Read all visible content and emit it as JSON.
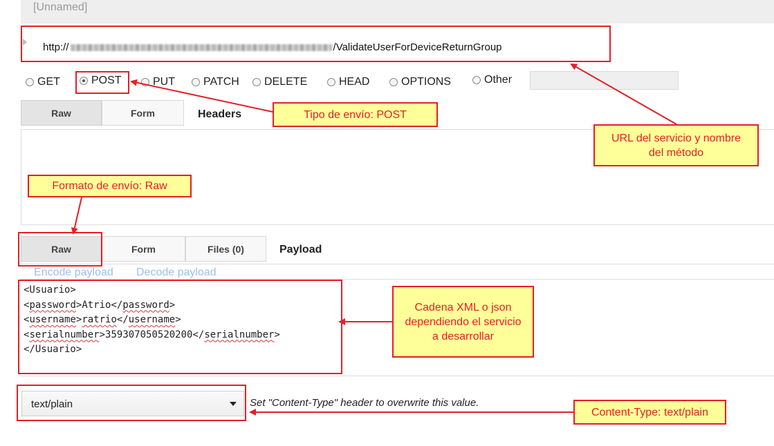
{
  "window": {
    "title": "[Unnamed]"
  },
  "request": {
    "url_prefix": "http://",
    "url_suffix": "/ValidateUserForDeviceReturnGroup"
  },
  "methods": [
    {
      "label": "GET",
      "selected": false
    },
    {
      "label": "POST",
      "selected": true
    },
    {
      "label": "PUT",
      "selected": false
    },
    {
      "label": "PATCH",
      "selected": false
    },
    {
      "label": "DELETE",
      "selected": false
    },
    {
      "label": "HEAD",
      "selected": false
    },
    {
      "label": "OPTIONS",
      "selected": false
    },
    {
      "label": "Other",
      "selected": false
    }
  ],
  "headers_section": {
    "tabs": [
      "Raw",
      "Form"
    ],
    "active_tab": "Raw",
    "label": "Headers"
  },
  "payload_section": {
    "tabs": [
      "Raw",
      "Form",
      "Files (0)"
    ],
    "active_tab": "Raw",
    "label": "Payload",
    "encode_link": "Encode payload",
    "decode_link": "Decode payload",
    "body_lines": [
      "<Usuario>",
      "<password>Atrio</password>",
      "<username>ratrio</username>",
      "<serialnumber>359307050520200</serialnumber>",
      "</Usuario>"
    ],
    "body_tags": {
      "usuario_open": "<Usuario>",
      "password_tag": "password",
      "password_value": "Atrio",
      "username_tag": "username",
      "username_value": "ratrio",
      "serial_tag": "serialnumber",
      "serial_value": "359307050520200",
      "usuario_close": "</Usuario>"
    }
  },
  "content_type": {
    "selected": "text/plain",
    "hint": "Set \"Content-Type\" header to overwrite this value."
  },
  "annotations": {
    "post": "Tipo de envío: POST",
    "url": "URL del servicio y nombre del método",
    "raw": "Formato de envío: Raw",
    "xml": "Cadena XML o json dependiendo el servicio a desarrollar",
    "content_type": "Content-Type: text/plain",
    "color": "#e32026",
    "fill": "#ffff99"
  }
}
